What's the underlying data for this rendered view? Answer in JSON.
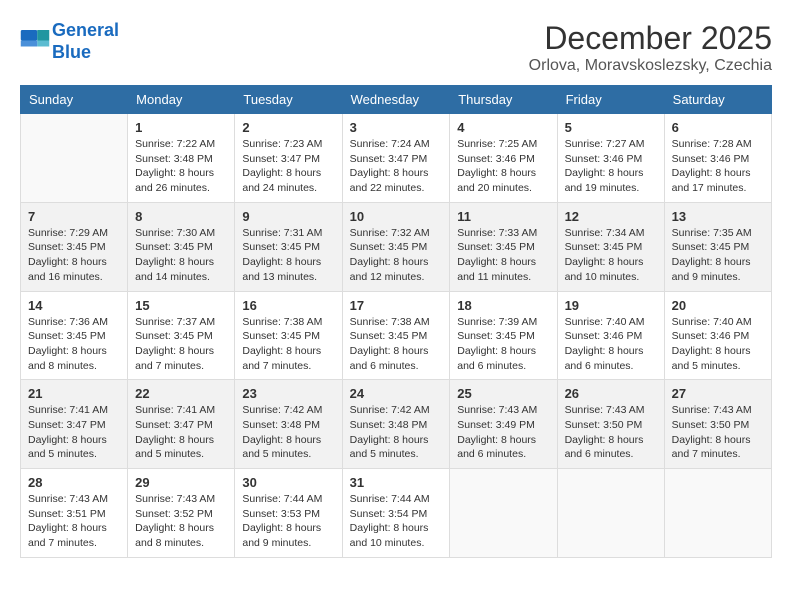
{
  "logo": {
    "line1": "General",
    "line2": "Blue"
  },
  "title": "December 2025",
  "location": "Orlova, Moravskoslezsky, Czechia",
  "days_header": [
    "Sunday",
    "Monday",
    "Tuesday",
    "Wednesday",
    "Thursday",
    "Friday",
    "Saturday"
  ],
  "weeks": [
    [
      {
        "day": "",
        "info": ""
      },
      {
        "day": "1",
        "info": "Sunrise: 7:22 AM\nSunset: 3:48 PM\nDaylight: 8 hours\nand 26 minutes."
      },
      {
        "day": "2",
        "info": "Sunrise: 7:23 AM\nSunset: 3:47 PM\nDaylight: 8 hours\nand 24 minutes."
      },
      {
        "day": "3",
        "info": "Sunrise: 7:24 AM\nSunset: 3:47 PM\nDaylight: 8 hours\nand 22 minutes."
      },
      {
        "day": "4",
        "info": "Sunrise: 7:25 AM\nSunset: 3:46 PM\nDaylight: 8 hours\nand 20 minutes."
      },
      {
        "day": "5",
        "info": "Sunrise: 7:27 AM\nSunset: 3:46 PM\nDaylight: 8 hours\nand 19 minutes."
      },
      {
        "day": "6",
        "info": "Sunrise: 7:28 AM\nSunset: 3:46 PM\nDaylight: 8 hours\nand 17 minutes."
      }
    ],
    [
      {
        "day": "7",
        "info": "Sunrise: 7:29 AM\nSunset: 3:45 PM\nDaylight: 8 hours\nand 16 minutes."
      },
      {
        "day": "8",
        "info": "Sunrise: 7:30 AM\nSunset: 3:45 PM\nDaylight: 8 hours\nand 14 minutes."
      },
      {
        "day": "9",
        "info": "Sunrise: 7:31 AM\nSunset: 3:45 PM\nDaylight: 8 hours\nand 13 minutes."
      },
      {
        "day": "10",
        "info": "Sunrise: 7:32 AM\nSunset: 3:45 PM\nDaylight: 8 hours\nand 12 minutes."
      },
      {
        "day": "11",
        "info": "Sunrise: 7:33 AM\nSunset: 3:45 PM\nDaylight: 8 hours\nand 11 minutes."
      },
      {
        "day": "12",
        "info": "Sunrise: 7:34 AM\nSunset: 3:45 PM\nDaylight: 8 hours\nand 10 minutes."
      },
      {
        "day": "13",
        "info": "Sunrise: 7:35 AM\nSunset: 3:45 PM\nDaylight: 8 hours\nand 9 minutes."
      }
    ],
    [
      {
        "day": "14",
        "info": "Sunrise: 7:36 AM\nSunset: 3:45 PM\nDaylight: 8 hours\nand 8 minutes."
      },
      {
        "day": "15",
        "info": "Sunrise: 7:37 AM\nSunset: 3:45 PM\nDaylight: 8 hours\nand 7 minutes."
      },
      {
        "day": "16",
        "info": "Sunrise: 7:38 AM\nSunset: 3:45 PM\nDaylight: 8 hours\nand 7 minutes."
      },
      {
        "day": "17",
        "info": "Sunrise: 7:38 AM\nSunset: 3:45 PM\nDaylight: 8 hours\nand 6 minutes."
      },
      {
        "day": "18",
        "info": "Sunrise: 7:39 AM\nSunset: 3:45 PM\nDaylight: 8 hours\nand 6 minutes."
      },
      {
        "day": "19",
        "info": "Sunrise: 7:40 AM\nSunset: 3:46 PM\nDaylight: 8 hours\nand 6 minutes."
      },
      {
        "day": "20",
        "info": "Sunrise: 7:40 AM\nSunset: 3:46 PM\nDaylight: 8 hours\nand 5 minutes."
      }
    ],
    [
      {
        "day": "21",
        "info": "Sunrise: 7:41 AM\nSunset: 3:47 PM\nDaylight: 8 hours\nand 5 minutes."
      },
      {
        "day": "22",
        "info": "Sunrise: 7:41 AM\nSunset: 3:47 PM\nDaylight: 8 hours\nand 5 minutes."
      },
      {
        "day": "23",
        "info": "Sunrise: 7:42 AM\nSunset: 3:48 PM\nDaylight: 8 hours\nand 5 minutes."
      },
      {
        "day": "24",
        "info": "Sunrise: 7:42 AM\nSunset: 3:48 PM\nDaylight: 8 hours\nand 5 minutes."
      },
      {
        "day": "25",
        "info": "Sunrise: 7:43 AM\nSunset: 3:49 PM\nDaylight: 8 hours\nand 6 minutes."
      },
      {
        "day": "26",
        "info": "Sunrise: 7:43 AM\nSunset: 3:50 PM\nDaylight: 8 hours\nand 6 minutes."
      },
      {
        "day": "27",
        "info": "Sunrise: 7:43 AM\nSunset: 3:50 PM\nDaylight: 8 hours\nand 7 minutes."
      }
    ],
    [
      {
        "day": "28",
        "info": "Sunrise: 7:43 AM\nSunset: 3:51 PM\nDaylight: 8 hours\nand 7 minutes."
      },
      {
        "day": "29",
        "info": "Sunrise: 7:43 AM\nSunset: 3:52 PM\nDaylight: 8 hours\nand 8 minutes."
      },
      {
        "day": "30",
        "info": "Sunrise: 7:44 AM\nSunset: 3:53 PM\nDaylight: 8 hours\nand 9 minutes."
      },
      {
        "day": "31",
        "info": "Sunrise: 7:44 AM\nSunset: 3:54 PM\nDaylight: 8 hours\nand 10 minutes."
      },
      {
        "day": "",
        "info": ""
      },
      {
        "day": "",
        "info": ""
      },
      {
        "day": "",
        "info": ""
      }
    ]
  ]
}
